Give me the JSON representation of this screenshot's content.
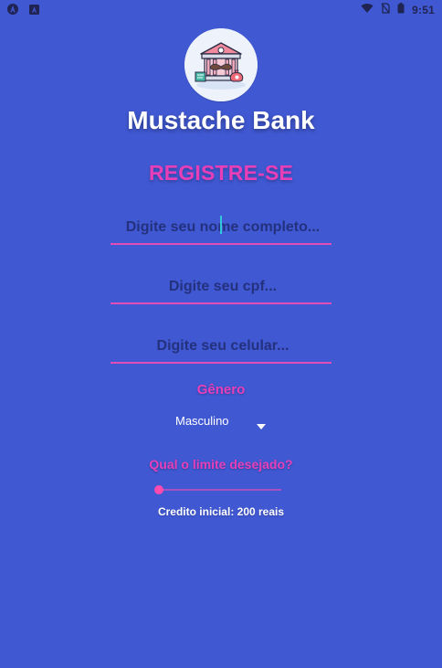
{
  "status_bar": {
    "time": "9:51"
  },
  "app": {
    "title": "Mustache Bank"
  },
  "register": {
    "title": "REGISTRE-SE",
    "name_placeholder": "Digite seu nome completo...",
    "cpf_placeholder": "Digite seu cpf...",
    "phone_placeholder": "Digite seu celular..."
  },
  "gender": {
    "label": "Gênero",
    "selected": "Masculino"
  },
  "limit": {
    "label": "Qual o limite desejado?",
    "credit_text": "Credito inicial: 200 reais",
    "slider_value": 0.0
  },
  "colors": {
    "background": "#4058D2",
    "accent": "#E83FB8",
    "text_light": "#FFFFFF",
    "placeholder": "#23317E"
  }
}
